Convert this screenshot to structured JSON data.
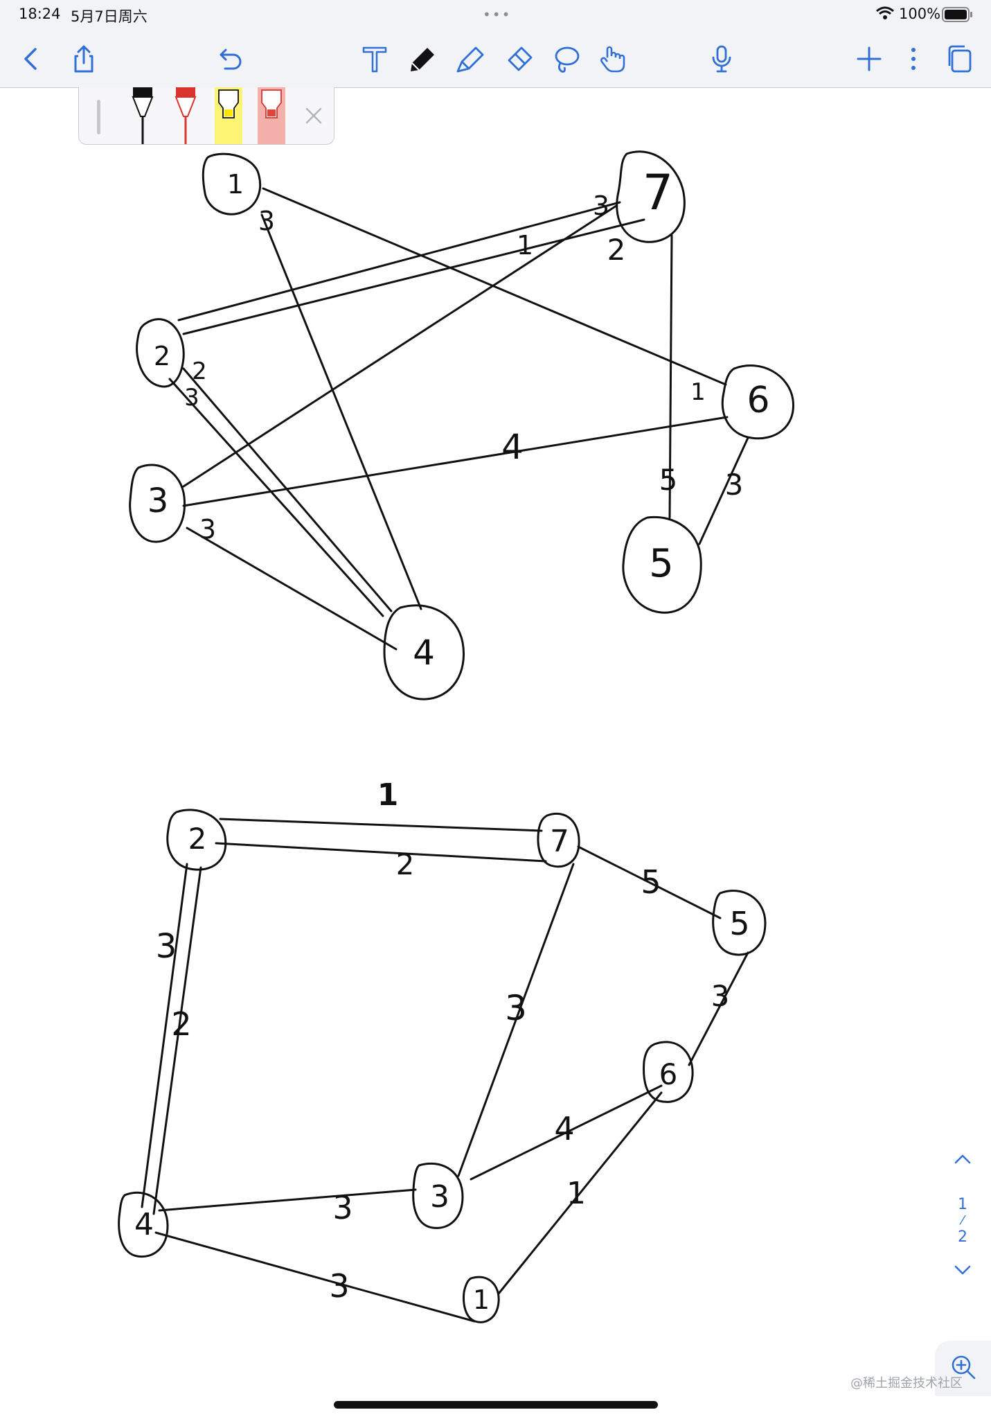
{
  "status_bar": {
    "time": "18:24",
    "date": "5月7日周六",
    "battery_percent": "100%"
  },
  "toolbar": {
    "icons": [
      "back-icon",
      "share-icon",
      "undo-icon",
      "text-tool-icon",
      "pen-tool-icon",
      "highlighter-tool-icon",
      "eraser-tool-icon",
      "lasso-tool-icon",
      "shape-tool-icon",
      "microphone-icon",
      "add-icon",
      "more-icon",
      "pages-icon"
    ],
    "accent_color": "#2f6fd6"
  },
  "pen_tray": {
    "pens": [
      {
        "name": "black-pen",
        "color": "#111111"
      },
      {
        "name": "red-pen",
        "color": "#d9342b"
      },
      {
        "name": "yellow-highlighter",
        "color": "#fff35c"
      },
      {
        "name": "pink-highlighter",
        "color": "#f3a9a3"
      }
    ]
  },
  "page_nav": {
    "current": "1",
    "total": "2"
  },
  "watermark": "@稀土掘金技术社区",
  "graph_top": {
    "nodes": [
      "1",
      "2",
      "3",
      "4",
      "5",
      "6",
      "7"
    ],
    "edge_weights": [
      "3",
      "1",
      "2",
      "3",
      "2",
      "3",
      "1",
      "4",
      "3",
      "5",
      "3"
    ]
  },
  "graph_bottom": {
    "nodes": [
      "2",
      "7",
      "5",
      "6",
      "3",
      "4",
      "1"
    ],
    "edge_weights": [
      "1",
      "2",
      "5",
      "3",
      "3",
      "2",
      "3",
      "4",
      "1",
      "3",
      "3"
    ]
  }
}
